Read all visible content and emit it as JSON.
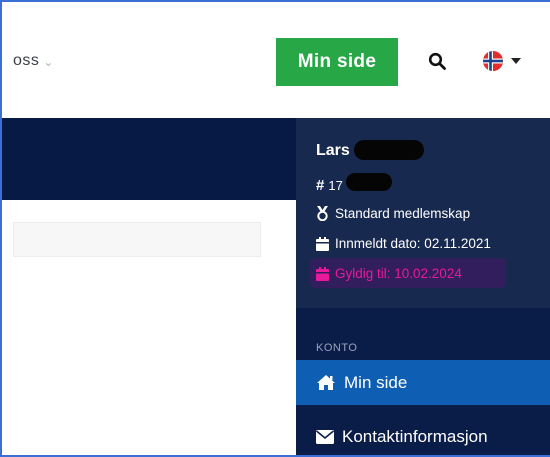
{
  "header": {
    "nav_about": "oss",
    "min_side_button": "Min side",
    "language": "Norsk"
  },
  "profile": {
    "name": "Lars",
    "member_id": "17",
    "membership": "Standard medlemskap",
    "joined": "Innmeldt dato: 02.11.2021",
    "valid_until": "Gyldig til: 10.02.2024"
  },
  "sidebar": {
    "section_label": "KONTO",
    "items": [
      {
        "label": "Min side",
        "icon": "home-icon",
        "active": true
      },
      {
        "label": "Kontaktinformasjon",
        "icon": "envelope-icon",
        "active": false
      }
    ]
  },
  "colors": {
    "accent_green": "#27a745",
    "navy": "#071a45",
    "active_blue": "#0e5eb3",
    "highlight_pink": "#e8199b"
  }
}
